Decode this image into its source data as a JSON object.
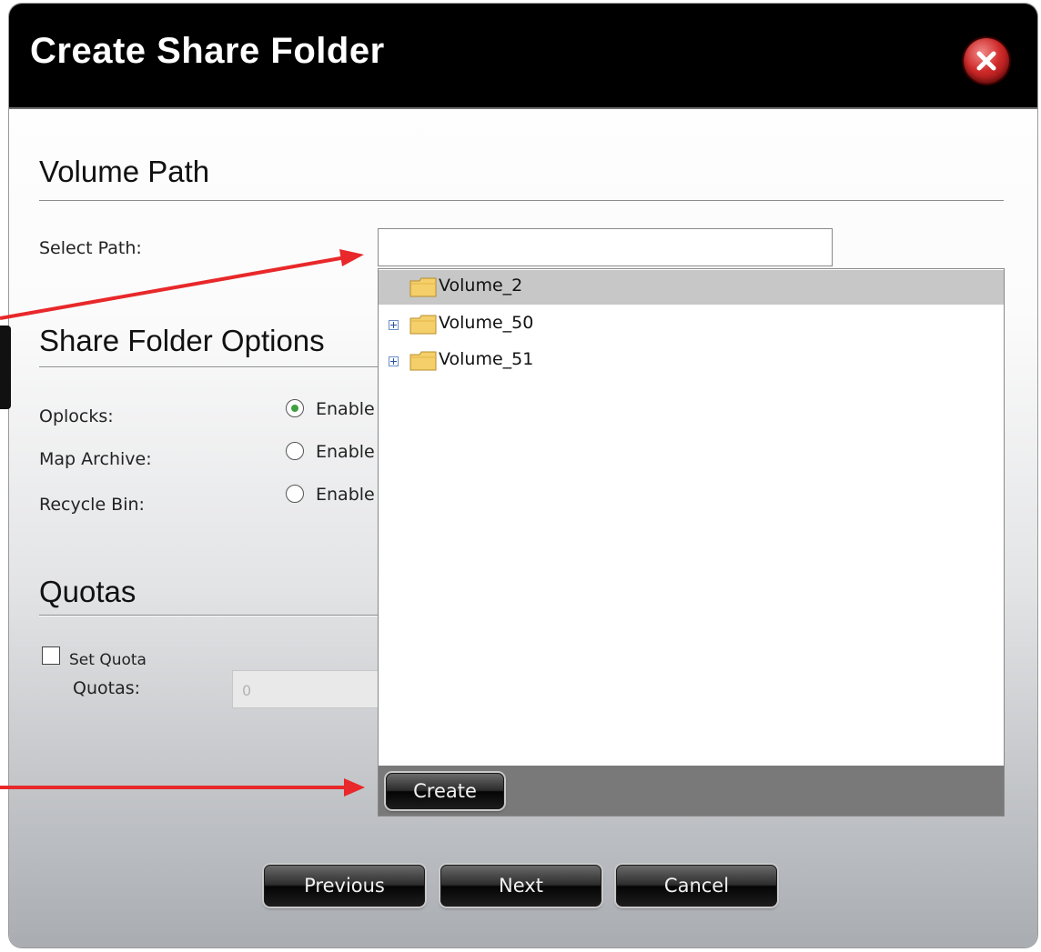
{
  "dialog": {
    "title": "Create Share Folder",
    "close_icon": "close-x-icon"
  },
  "volume_path": {
    "heading": "Volume Path",
    "select_path_label": "Select Path:",
    "select_path_value": ""
  },
  "tree": {
    "items": [
      {
        "label": "Volume_2",
        "expandable": false,
        "selected": true
      },
      {
        "label": "Volume_50",
        "expandable": true,
        "selected": false
      },
      {
        "label": "Volume_51",
        "expandable": true,
        "selected": false
      }
    ],
    "create_label": "Create"
  },
  "share_options": {
    "heading": "Share Folder Options",
    "oplocks_label": "Oplocks:",
    "oplocks_option": "Enable",
    "oplocks_checked": true,
    "map_archive_label": "Map Archive:",
    "map_archive_option": "Enable",
    "recycle_bin_label": "Recycle Bin:",
    "recycle_bin_option": "Enable"
  },
  "quotas": {
    "heading": "Quotas",
    "set_quota_label": "Set Quota",
    "quotas_label": "Quotas:",
    "quotas_value": "0"
  },
  "footer": {
    "previous_label": "Previous",
    "next_label": "Next",
    "cancel_label": "Cancel"
  },
  "colors": {
    "title_bar": "#000000",
    "close_button": "#d02a2a",
    "annotation_arrow": "#e8282a",
    "radio_checked": "#3ea03e",
    "selected_row": "#c7c7c7"
  }
}
